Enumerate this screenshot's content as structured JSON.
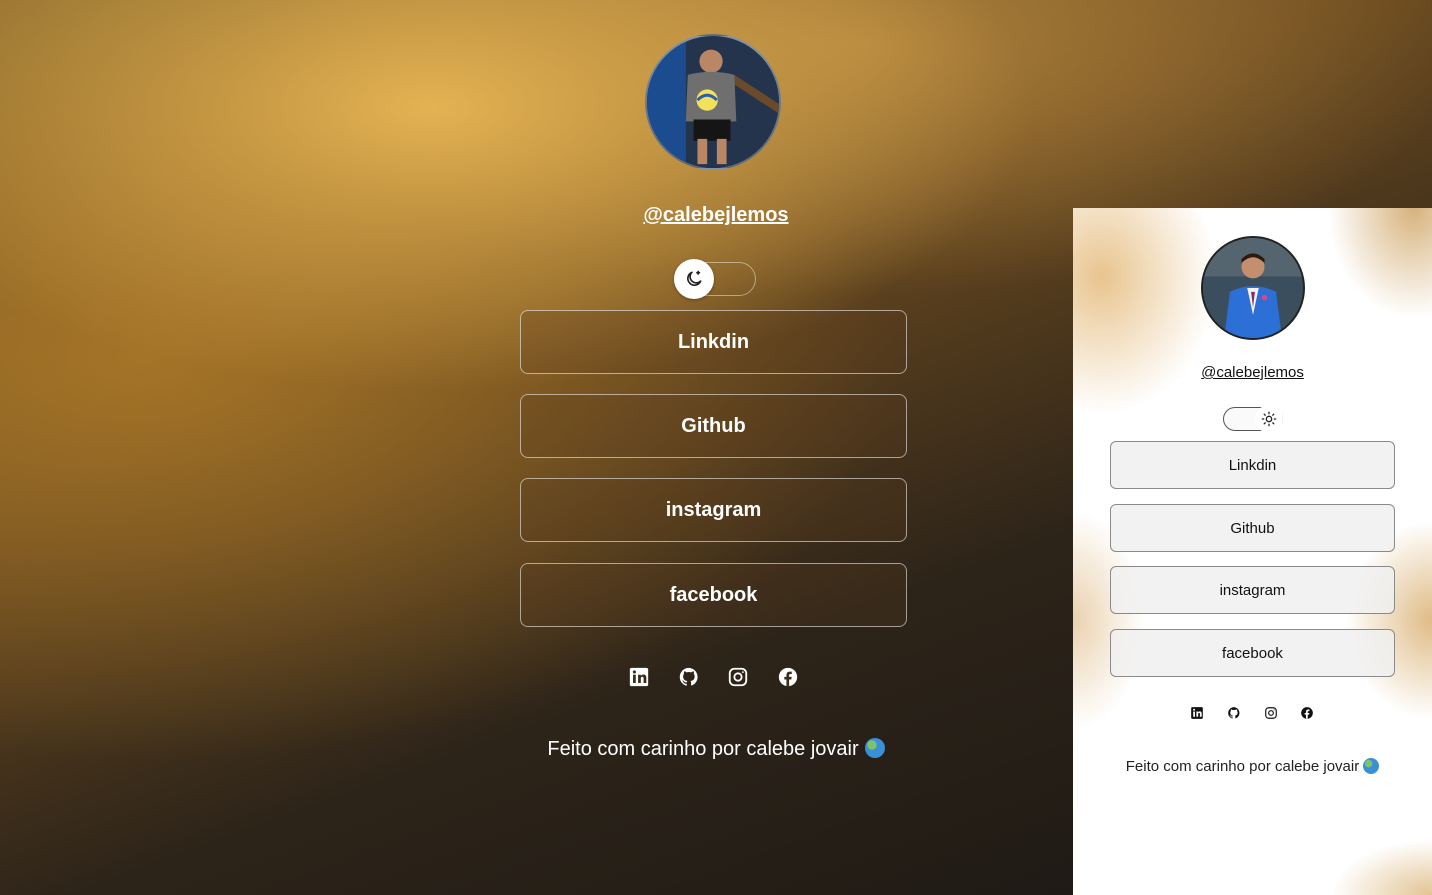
{
  "dark": {
    "handle": "@calebejlemos",
    "theme_toggle": "moon-icon",
    "buttons": [
      {
        "label": "Linkdin"
      },
      {
        "label": "Github"
      },
      {
        "label": "instagram"
      },
      {
        "label": "facebook"
      }
    ],
    "social_icons": [
      "linkedin-icon",
      "github-icon",
      "instagram-icon",
      "facebook-icon"
    ],
    "footer": "Feito com carinho por calebe jovair"
  },
  "light": {
    "handle": "@calebejlemos",
    "theme_toggle": "sun-icon",
    "buttons": [
      {
        "label": "Linkdin"
      },
      {
        "label": "Github"
      },
      {
        "label": "instagram"
      },
      {
        "label": "facebook"
      }
    ],
    "social_icons": [
      "linkedin-icon",
      "github-icon",
      "instagram-icon",
      "facebook-icon"
    ],
    "footer": "Feito com carinho por calebe jovair"
  },
  "colors": {
    "dark_accent": "#e2b253",
    "dark_bg": "#1b1714",
    "light_bg": "#ffffff"
  }
}
